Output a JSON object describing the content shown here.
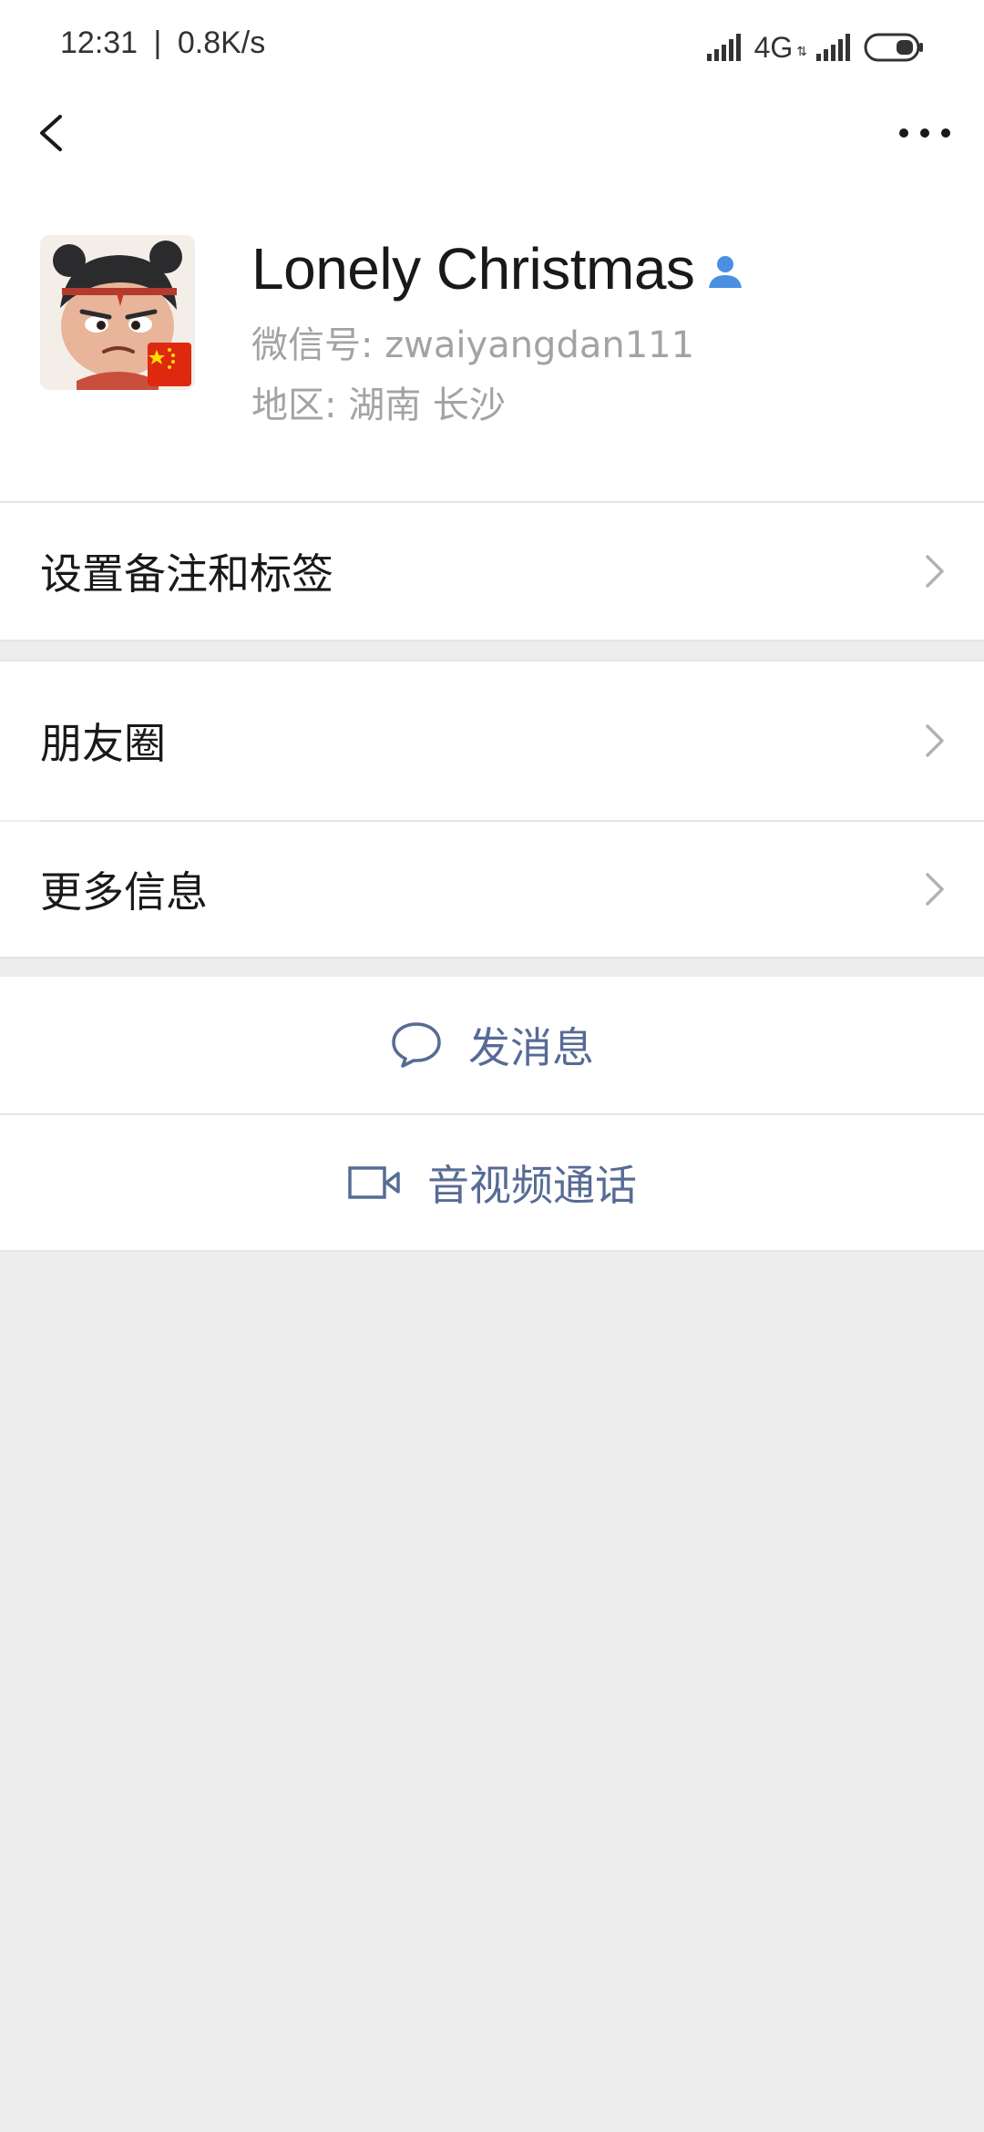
{
  "status_bar": {
    "time": "12:31",
    "separator": "|",
    "speed": "0.8K/s",
    "network": "4G",
    "network_sub": "⇅"
  },
  "nav": {
    "back_icon": "chevron-left-icon",
    "more_icon": "ellipsis-icon"
  },
  "profile": {
    "name": "Lonely Christmas",
    "wechat_id": "微信号: zwaiyangdan111",
    "region": "地区: 湖南  长沙",
    "verify_icon": "person-icon"
  },
  "cells": {
    "remark": "设置备注和标签",
    "moments": "朋友圈",
    "more_info": "更多信息"
  },
  "actions": {
    "message": "发消息",
    "call": "音视频通话"
  },
  "colors": {
    "page_bg": "#ededed",
    "cell_bg": "#ffffff",
    "link": "#576b95",
    "secondary_text": "#a3a3a3",
    "verify_blue": "#4a90e2"
  }
}
